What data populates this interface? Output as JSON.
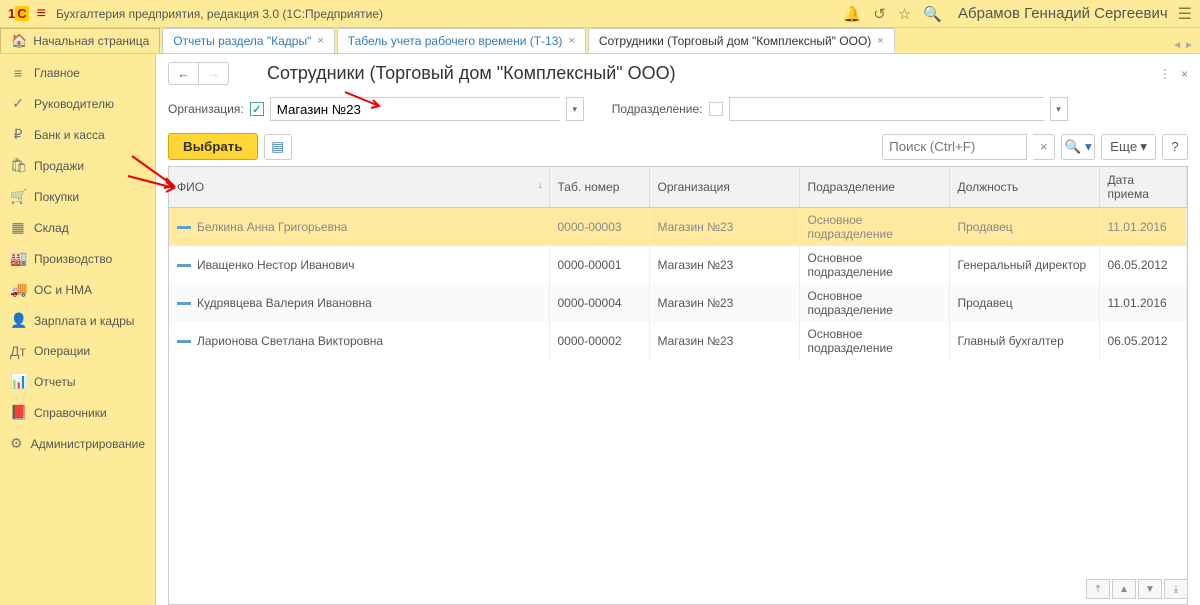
{
  "appTitle": "Бухгалтерия предприятия, редакция 3.0  (1С:Предприятие)",
  "userName": "Абрамов Геннадий Сергеевич",
  "homeTabLabel": "Начальная страница",
  "tabs": [
    {
      "label": "Отчеты раздела \"Кадры\""
    },
    {
      "label": "Табель учета рабочего времени (Т-13)"
    },
    {
      "label": "Сотрудники (Торговый дом \"Комплексный\" ООО)"
    }
  ],
  "sidebar": [
    {
      "icon": "≡",
      "label": "Главное"
    },
    {
      "icon": "✓",
      "label": "Руководителю"
    },
    {
      "icon": "₽",
      "label": "Банк и касса"
    },
    {
      "icon": "🛍",
      "label": "Продажи"
    },
    {
      "icon": "🛒",
      "label": "Покупки"
    },
    {
      "icon": "▦",
      "label": "Склад"
    },
    {
      "icon": "🏭",
      "label": "Производство"
    },
    {
      "icon": "🚚",
      "label": "ОС и НМА"
    },
    {
      "icon": "👤",
      "label": "Зарплата и кадры"
    },
    {
      "icon": "Дт",
      "label": "Операции"
    },
    {
      "icon": "📊",
      "label": "Отчеты"
    },
    {
      "icon": "📕",
      "label": "Справочники"
    },
    {
      "icon": "⚙",
      "label": "Администрирование"
    }
  ],
  "pageTitle": "Сотрудники (Торговый дом \"Комплексный\" ООО)",
  "filter": {
    "orgLabel": "Организация:",
    "orgValue": "Магазин №23",
    "deptLabel": "Подразделение:",
    "deptValue": ""
  },
  "toolbar": {
    "selectLabel": "Выбрать",
    "searchPlaceholder": "Поиск (Ctrl+F)",
    "moreLabel": "Еще"
  },
  "columns": {
    "fio": "ФИО",
    "tab": "Таб. номер",
    "org": "Организация",
    "dept": "Подразделение",
    "pos": "Должность",
    "date": "Дата приема"
  },
  "rows": [
    {
      "fio": "Белкина Анна Григорьевна",
      "tab": "0000-00003",
      "org": "Магазин №23",
      "dept": "Основное подразделение",
      "pos": "Продавец",
      "date": "11.01.2016"
    },
    {
      "fio": "Иващенко Нестор Иванович",
      "tab": "0000-00001",
      "org": "Магазин №23",
      "dept": "Основное подразделение",
      "pos": "Генеральный директор",
      "date": "06.05.2012"
    },
    {
      "fio": "Кудрявцева Валерия Ивановна",
      "tab": "0000-00004",
      "org": "Магазин №23",
      "dept": "Основное подразделение",
      "pos": "Продавец",
      "date": "11.01.2016"
    },
    {
      "fio": "Ларионова Светлана Викторовна",
      "tab": "0000-00002",
      "org": "Магазин №23",
      "dept": "Основное подразделение",
      "pos": "Главный бухгалтер",
      "date": "06.05.2012"
    }
  ]
}
